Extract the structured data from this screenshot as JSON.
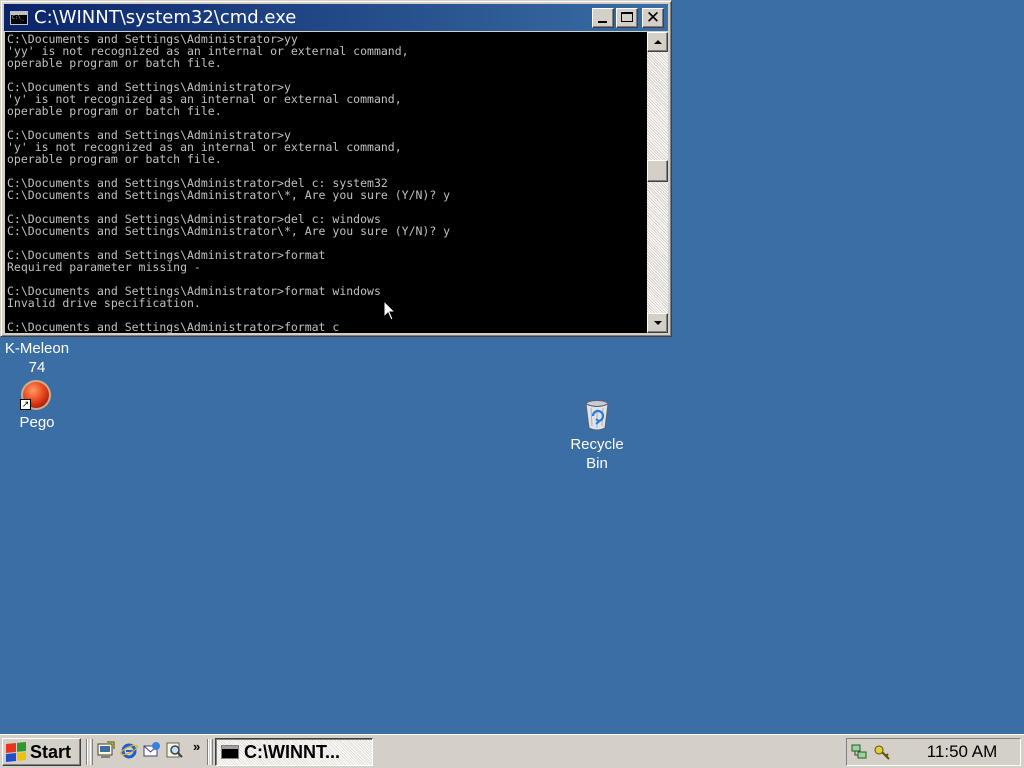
{
  "window": {
    "title": "C:\\WINNT\\system32\\cmd.exe",
    "console_lines": [
      "C:\\Documents and Settings\\Administrator>yy",
      "'yy' is not recognized as an internal or external command,",
      "operable program or batch file.",
      "",
      "C:\\Documents and Settings\\Administrator>y",
      "'y' is not recognized as an internal or external command,",
      "operable program or batch file.",
      "",
      "C:\\Documents and Settings\\Administrator>y",
      "'y' is not recognized as an internal or external command,",
      "operable program or batch file.",
      "",
      "C:\\Documents and Settings\\Administrator>del c: system32",
      "C:\\Documents and Settings\\Administrator\\*, Are you sure (Y/N)? y",
      "",
      "C:\\Documents and Settings\\Administrator>del c: windows",
      "C:\\Documents and Settings\\Administrator\\*, Are you sure (Y/N)? y",
      "",
      "C:\\Documents and Settings\\Administrator>format",
      "Required parameter missing -",
      "",
      "C:\\Documents and Settings\\Administrator>format windows",
      "Invalid drive specification.",
      "",
      "C:\\Documents and Settings\\Administrator>format c"
    ],
    "scroll_position": 0.45
  },
  "desktop": {
    "icons": [
      {
        "label_line1": "K-Meleon",
        "label_line2": "74"
      },
      {
        "label": "Pego",
        "icon": "pego-icon"
      },
      {
        "label_line1": "Recycle",
        "label_line2": "Bin",
        "icon": "recycle-bin-icon"
      }
    ]
  },
  "taskbar": {
    "start_label": "Start",
    "quick_launch": [
      "show-desktop-icon",
      "internet-explorer-icon",
      "outlook-express-icon",
      "search-icon"
    ],
    "more_label": "»",
    "task_label": "C:\\WINNT...",
    "clock": "11:50 AM"
  },
  "colors": {
    "desktop": "#3a6ea5",
    "titlebar_start": "#0a246a",
    "titlebar_end": "#3a6ea5",
    "console_bg": "#000000",
    "console_fg": "#c0c0c0",
    "chrome": "#d4d0c8"
  }
}
